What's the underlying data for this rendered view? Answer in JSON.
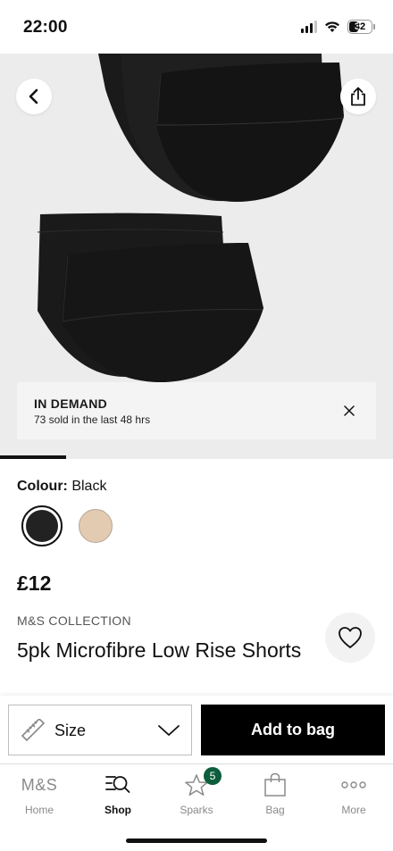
{
  "status_bar": {
    "time": "22:00",
    "battery": "32"
  },
  "hero": {
    "banner_title": "IN DEMAND",
    "banner_text": "73 sold in the last 48 hrs"
  },
  "product": {
    "colour_label": "Colour:",
    "colour_value": "Black",
    "swatches": [
      {
        "name": "black",
        "color": "#222222"
      },
      {
        "name": "nude",
        "color": "#e3cbb2"
      }
    ],
    "price": "£12",
    "brand": "M&S COLLECTION",
    "title": "5pk Microfibre Low Rise Shorts"
  },
  "actions": {
    "size_label": "Size",
    "add_to_bag": "Add to bag"
  },
  "tabs": [
    {
      "label": "Home",
      "icon": "ms-logo",
      "logo_text": "M&S"
    },
    {
      "label": "Shop",
      "icon": "shop-search-icon",
      "active": true
    },
    {
      "label": "Sparks",
      "icon": "sparks-star-icon",
      "badge": "5"
    },
    {
      "label": "Bag",
      "icon": "bag-icon"
    },
    {
      "label": "More",
      "icon": "more-dots-icon"
    }
  ]
}
